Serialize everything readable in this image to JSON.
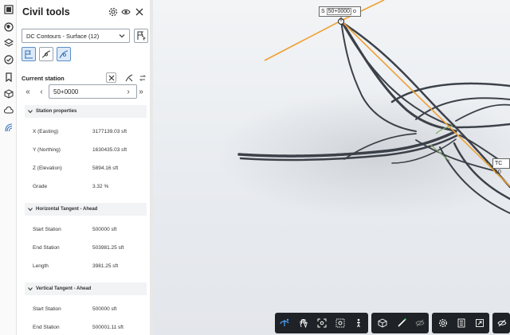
{
  "panel": {
    "title": "Civil tools",
    "surface_select": "DC Contours - Surface (12)",
    "current_station_label": "Current station",
    "station_value": "50+0000"
  },
  "sections": {
    "station_properties": {
      "title": "Station properties",
      "rows": [
        {
          "k": "X (Easting)",
          "v": "3177139.03 sft"
        },
        {
          "k": "Y (Northing)",
          "v": "1630435.03 sft"
        },
        {
          "k": "Z (Elevation)",
          "v": "5894.16 sft"
        },
        {
          "k": "Grade",
          "v": "3.32 %"
        }
      ]
    },
    "horizontal_tangent": {
      "title": "Horizontal Tangent - Ahead",
      "rows": [
        {
          "k": "Start Station",
          "v": "500000 sft"
        },
        {
          "k": "End Station",
          "v": "503981.25 sft"
        },
        {
          "k": "Length",
          "v": "3981.25 sft"
        }
      ]
    },
    "vertical_tangent": {
      "title": "Vertical Tangent - Ahead",
      "rows": [
        {
          "k": "Start Station",
          "v": "500000 sft"
        },
        {
          "k": "End Station",
          "v": "500001.11 sft"
        }
      ]
    }
  },
  "viewport": {
    "station_tag_prefix": "S",
    "station_tag_value": "50+0000",
    "station_tag_suffix": "o",
    "tc_tag": "TC 50"
  },
  "colors": {
    "accent": "#5b8fc9",
    "alignment": "#f0a032",
    "toolbar_bg": "#1f2226"
  }
}
